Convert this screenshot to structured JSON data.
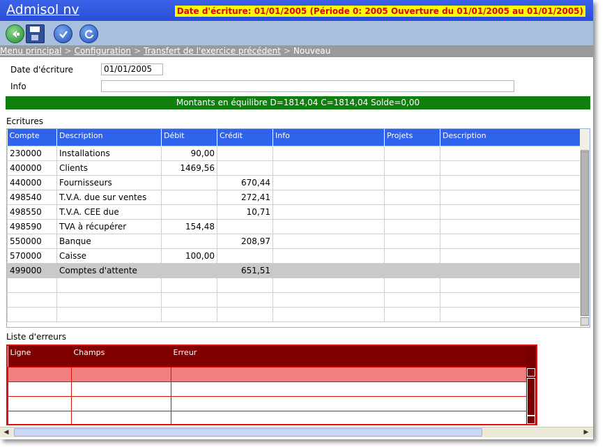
{
  "header": {
    "app_title": "Admisol nv",
    "period_info": "Date d'écriture: 01/01/2005 (Période 0: 2005 Ouverture du 01/01/2005 au 01/01/2005)"
  },
  "breadcrumb": {
    "items": [
      "Menu principal",
      "Configuration",
      "Transfert de l'exercice précédent"
    ],
    "current": "Nouveau",
    "separator": ">"
  },
  "form": {
    "date_label": "Date d'écriture",
    "date_value": "01/01/2005",
    "info_label": "Info",
    "info_value": ""
  },
  "balance_bar": {
    "text": "Montants en équilibre D=1814,04 C=1814,04 Solde=0,00",
    "color": "#0f7f0f"
  },
  "ecritures": {
    "label": "Ecritures",
    "columns": [
      "Compte",
      "Description",
      "Débit",
      "Crédit",
      "Info",
      "Projets",
      "Description"
    ],
    "rows": [
      {
        "compte": "230000",
        "description": "Installations",
        "debit": "90,00",
        "credit": "",
        "info": "",
        "projets": "",
        "description2": ""
      },
      {
        "compte": "400000",
        "description": "Clients",
        "debit": "1469,56",
        "credit": "",
        "info": "",
        "projets": "",
        "description2": ""
      },
      {
        "compte": "440000",
        "description": "Fournisseurs",
        "debit": "",
        "credit": "670,44",
        "info": "",
        "projets": "",
        "description2": ""
      },
      {
        "compte": "498540",
        "description": "T.V.A. due sur ventes",
        "debit": "",
        "credit": "272,41",
        "info": "",
        "projets": "",
        "description2": ""
      },
      {
        "compte": "498550",
        "description": "T.V.A. CEE due",
        "debit": "",
        "credit": "10,71",
        "info": "",
        "projets": "",
        "description2": ""
      },
      {
        "compte": "498590",
        "description": "TVA à récupérer",
        "debit": "154,48",
        "credit": "",
        "info": "",
        "projets": "",
        "description2": ""
      },
      {
        "compte": "550000",
        "description": "Banque",
        "debit": "",
        "credit": "208,97",
        "info": "",
        "projets": "",
        "description2": ""
      },
      {
        "compte": "570000",
        "description": "Caisse",
        "debit": "100,00",
        "credit": "",
        "info": "",
        "projets": "",
        "description2": ""
      },
      {
        "compte": "499000",
        "description": "Comptes d'attente",
        "debit": "",
        "credit": "651,51",
        "info": "",
        "projets": "",
        "description2": ""
      },
      {
        "compte": "",
        "description": "",
        "debit": "",
        "credit": "",
        "info": "",
        "projets": "",
        "description2": ""
      },
      {
        "compte": "",
        "description": "",
        "debit": "",
        "credit": "",
        "info": "",
        "projets": "",
        "description2": ""
      },
      {
        "compte": "",
        "description": "",
        "debit": "",
        "credit": "",
        "info": "",
        "projets": "",
        "description2": ""
      }
    ]
  },
  "erreurs": {
    "label": "Liste d'erreurs",
    "columns": [
      "Ligne",
      "Champs",
      "Erreur"
    ],
    "rows": [
      {
        "ligne": "",
        "champs": "",
        "erreur": ""
      },
      {
        "ligne": "",
        "champs": "",
        "erreur": ""
      },
      {
        "ligne": "",
        "champs": "",
        "erreur": ""
      },
      {
        "ligne": "",
        "champs": "",
        "erreur": ""
      }
    ]
  },
  "toolbar": {
    "buttons": [
      "back-icon",
      "save-icon",
      "validate-icon",
      "refresh-icon"
    ]
  },
  "colors": {
    "title_bar": "#2a4fd6",
    "toolbar": "#a8bfe0",
    "grid_header": "#2f63ec",
    "error_header": "#800000",
    "period_bg": "#ffff00",
    "period_text": "#e00000"
  }
}
